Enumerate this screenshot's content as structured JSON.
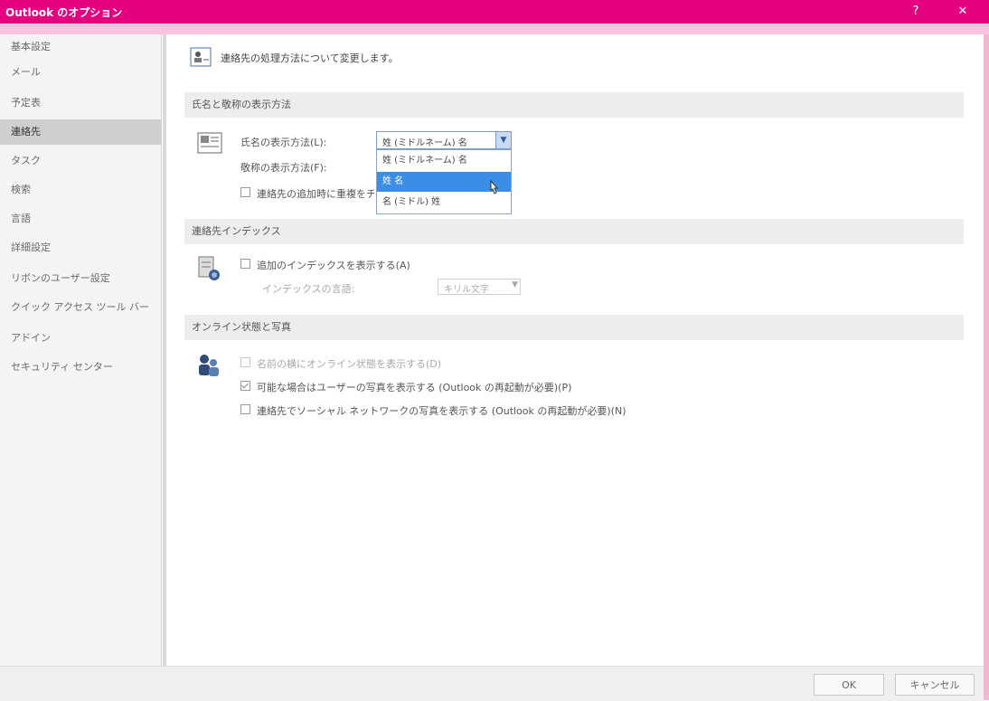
{
  "window": {
    "title": "Outlook のオプション",
    "help_glyph": "?",
    "close_glyph": "✕",
    "accent_color": "#e4007f"
  },
  "sidebar": {
    "items": [
      {
        "label": "基本設定"
      },
      {
        "label": "メール"
      },
      {
        "label": "予定表"
      },
      {
        "label": "連絡先",
        "selected": true
      },
      {
        "label": "タスク"
      },
      {
        "label": "検索"
      },
      {
        "label": "言語"
      },
      {
        "label": "詳細設定"
      },
      {
        "label": "リボンのユーザー設定"
      },
      {
        "label": "クイック アクセス ツール バー"
      },
      {
        "label": "アドイン"
      },
      {
        "label": "セキュリティ センター"
      }
    ]
  },
  "content": {
    "intro": "連絡先の処理方法について変更します。",
    "names_section": {
      "header": "氏名と敬称の表示方法",
      "full_name_label": "氏名の表示方法(L):",
      "file_as_label": "敬称の表示方法(F):",
      "check_duplicates_label": "連絡先の追加時に重複をチェックする(C)",
      "combo_value": "姓 (ミドルネーム) 名",
      "options": [
        {
          "label": "姓 (ミドルネーム) 名"
        },
        {
          "label": "姓 名",
          "highlighted": true
        },
        {
          "label": "名 (ミドル) 姓"
        }
      ]
    },
    "index_section": {
      "header": "連絡先インデックス",
      "show_index_label": "追加のインデックスを表示する(A)",
      "index_language_label": "インデックスの言語:",
      "index_language_value": "キリル文字"
    },
    "online_section": {
      "header": "オンライン状態と写真",
      "option1": "名前の横にオンライン状態を表示する(D)",
      "option2": "可能な場合はユーザーの写真を表示する (Outlook の再起動が必要)(P)",
      "option3": "連絡先でソーシャル ネットワークの写真を表示する (Outlook の再起動が必要)(N)"
    }
  },
  "footer": {
    "ok_label": "OK",
    "cancel_label": "キャンセル"
  }
}
